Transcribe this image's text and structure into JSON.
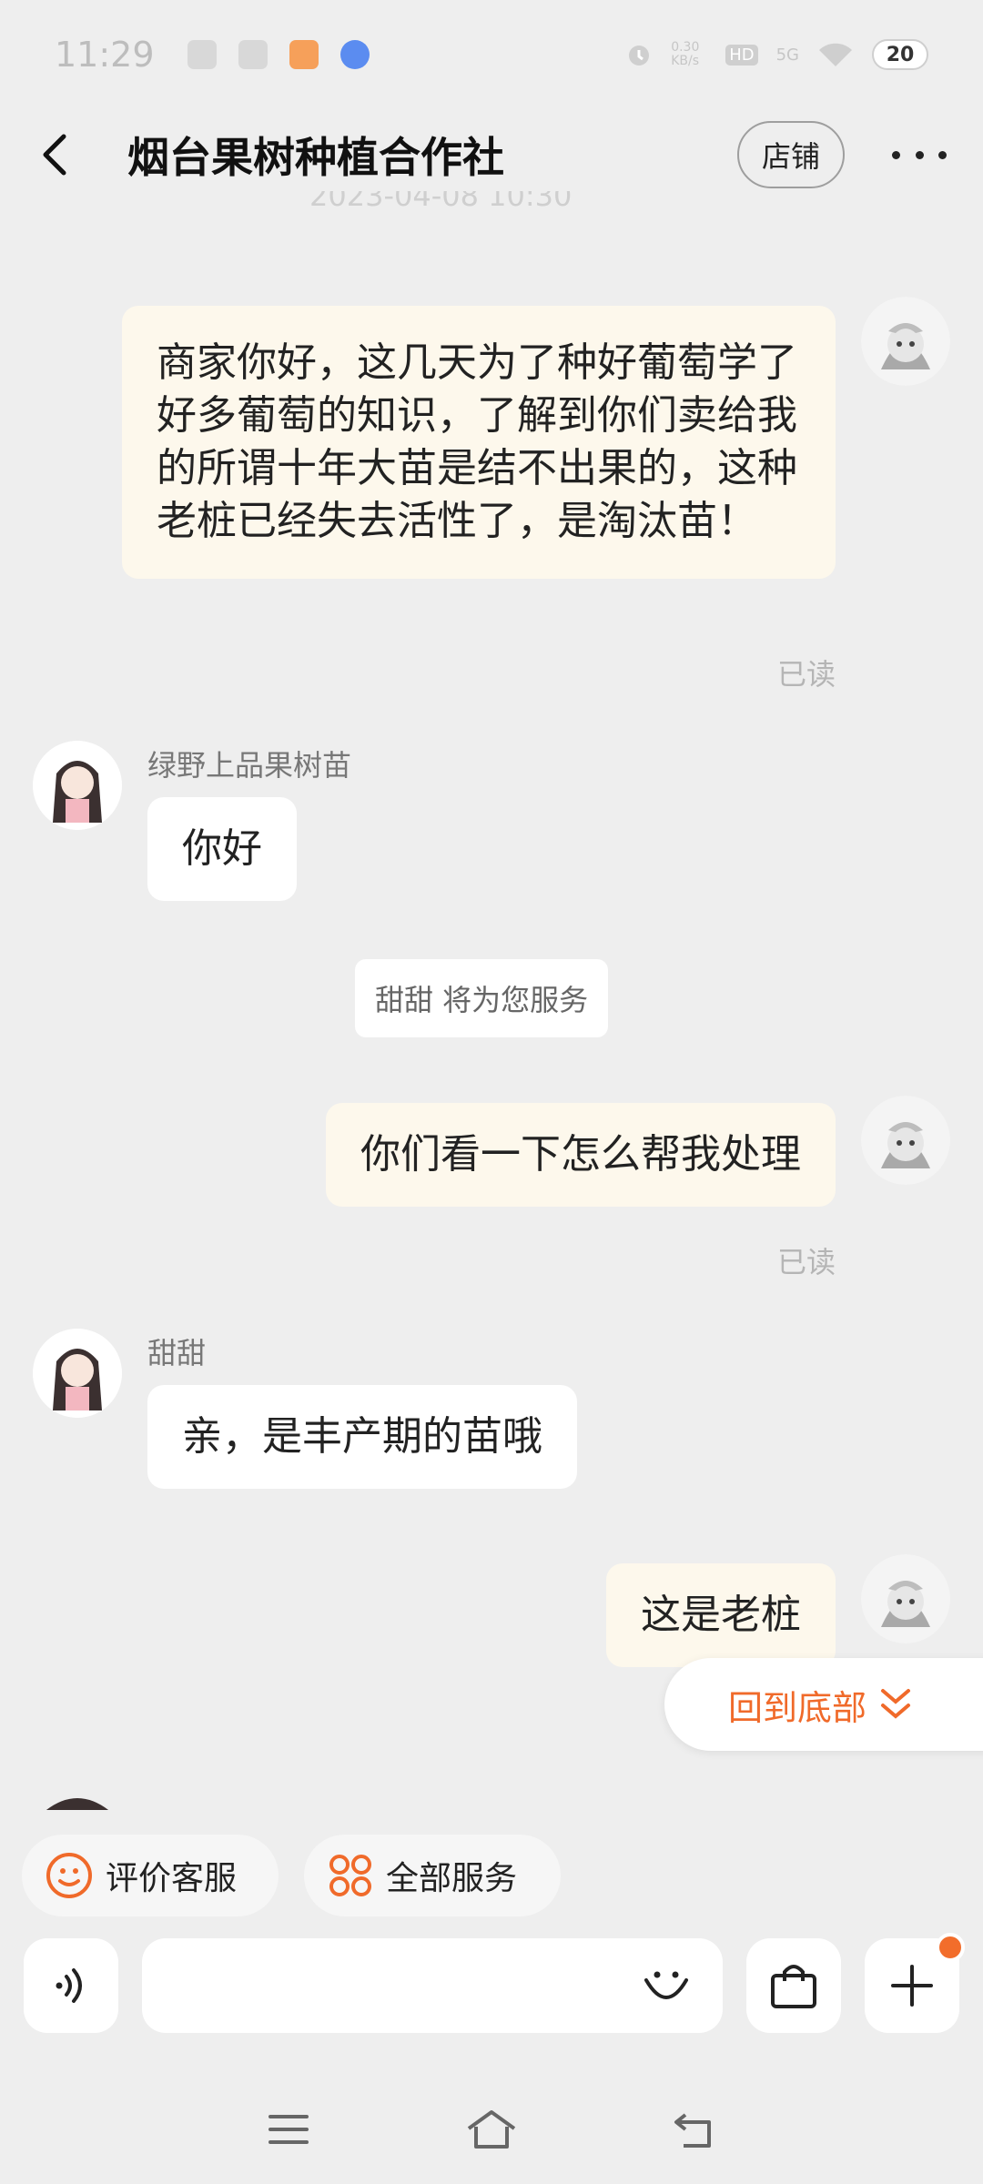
{
  "status_bar": {
    "time": "11:29",
    "speed": "0.30 KB/s",
    "hd": "HD",
    "network": "5G",
    "battery": "20"
  },
  "nav": {
    "title": "烟台果树种植合作社",
    "shop_label": "店铺"
  },
  "chat": {
    "messages": [
      {
        "from": "me",
        "text": "商家你好，这几天为了种好葡萄学了好多葡萄的知识，了解到你们卖给我的所谓十年大苗是结不出果的，这种老桩已经失去活性了，是淘汰苗！",
        "status": "已读"
      },
      {
        "from": "other",
        "sender": "绿野上品果树苗",
        "text": "你好"
      },
      {
        "from": "system",
        "text": "甜甜 将为您服务"
      },
      {
        "from": "me",
        "text": "你们看一下怎么帮我处理",
        "status": "已读"
      },
      {
        "from": "other",
        "sender": "甜甜",
        "text": "亲，是丰产期的苗哦"
      },
      {
        "from": "me",
        "text": "这是老桩"
      }
    ],
    "back_to_bottom": "回到底部"
  },
  "quick_actions": {
    "rate_service": "评价客服",
    "all_services": "全部服务"
  },
  "input": {
    "placeholder": ""
  },
  "colors": {
    "accent": "#f06a2a",
    "my_bubble": "#fdf8ec",
    "other_bubble": "#ffffff",
    "background": "#eeeeee"
  },
  "icons": [
    "back-arrow-icon",
    "more-icon",
    "voice-icon",
    "emoji-icon",
    "shopping-bag-icon",
    "plus-icon",
    "smile-icon",
    "grid-icon",
    "double-chevron-down-icon",
    "menu-icon",
    "home-icon",
    "back-icon"
  ]
}
